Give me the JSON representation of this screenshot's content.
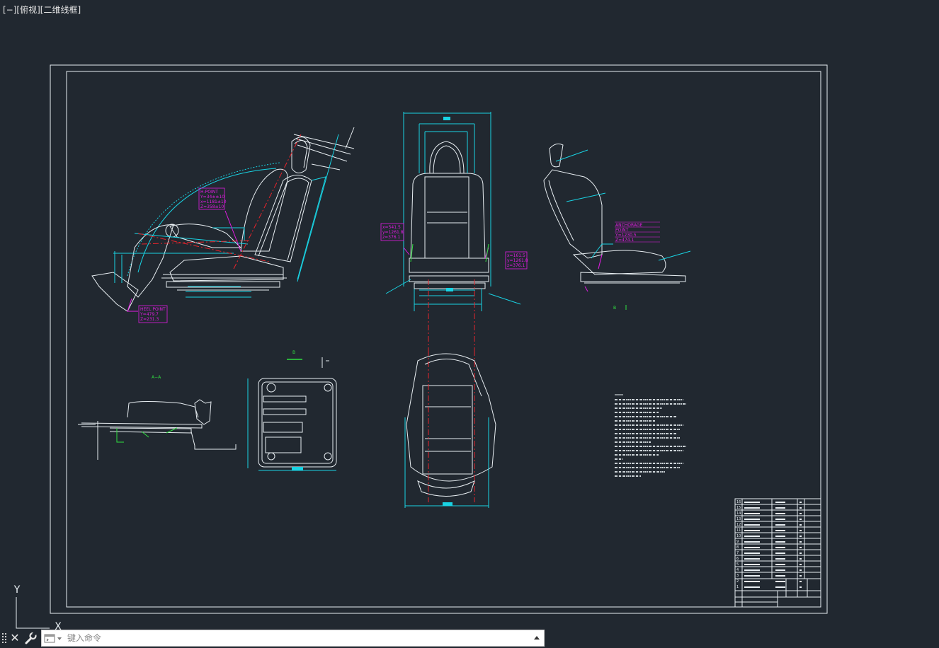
{
  "viewport": {
    "label": "[−][俯视][二维线框]",
    "background": "#212830"
  },
  "colors": {
    "line_white": "#e8eef2",
    "cyan": "#19d3e3",
    "magenta": "#e31ce3",
    "red": "#e8242b",
    "green": "#30e040",
    "yellow": "#e0e040"
  },
  "drawing": {
    "section_label_aa": "A−A",
    "section_label_b": "B",
    "view_label_b_side": "B",
    "hpoint": {
      "title": "H-POINT",
      "y": "Y=34±±10",
      "x": "x=1181±10",
      "z": "Z=358±10"
    },
    "heelpoint": {
      "title": "HEEL POINT",
      "y": "Y=479.7",
      "z": "Z=231.3"
    },
    "front_left": {
      "x": "x=541.5",
      "y": "y=1261.8",
      "z": "z=376.1"
    },
    "front_right": {
      "x": "x=161.5",
      "y": "y=1261.8",
      "z": "z=376.1"
    },
    "anchorage": {
      "title": "ANCHORAGE",
      "point": "POINT",
      "y": "Y=1230.5",
      "z": "Z=474.1"
    }
  },
  "title_block": {
    "rows": [
      "16",
      "15",
      "14",
      "13",
      "12",
      "11",
      "10",
      "9",
      "8",
      "7",
      "6",
      "5",
      "4",
      "3",
      "2",
      "1"
    ]
  },
  "ucs": {
    "y_label": "Y",
    "x_label": "X"
  },
  "command_line": {
    "placeholder": "键入命令",
    "close_label": "✕"
  }
}
